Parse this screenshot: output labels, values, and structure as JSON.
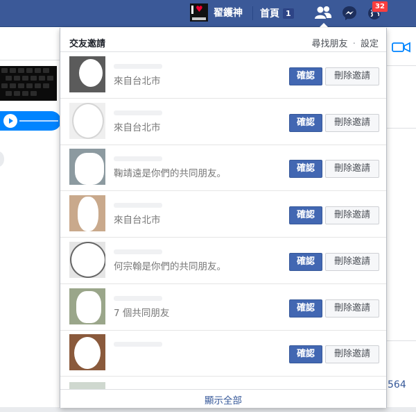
{
  "topbar": {
    "profile_name": "翟鑊神",
    "home_label": "首頁",
    "home_count": "1",
    "notification_count": "32",
    "colors": {
      "bar": "#3b5998",
      "badge": "#fa3e3e"
    }
  },
  "friend_requests": {
    "title": "交友邀請",
    "find_friends_link": "尋找朋友",
    "separator": "·",
    "settings_link": "設定",
    "confirm_label": "確認",
    "delete_label": "刪除邀請",
    "requests": [
      {
        "subtitle": "來自台北市"
      },
      {
        "subtitle": "來自台北市"
      },
      {
        "subtitle": "鞠靖遠是你們的共同朋友。"
      },
      {
        "subtitle": "來自台北市"
      },
      {
        "subtitle": "何宗翰是你們的共同朋友。"
      },
      {
        "subtitle": "7 個共同朋友"
      },
      {
        "subtitle": ""
      }
    ],
    "show_all": "顯示全部"
  },
  "background": {
    "right_number": "564"
  }
}
